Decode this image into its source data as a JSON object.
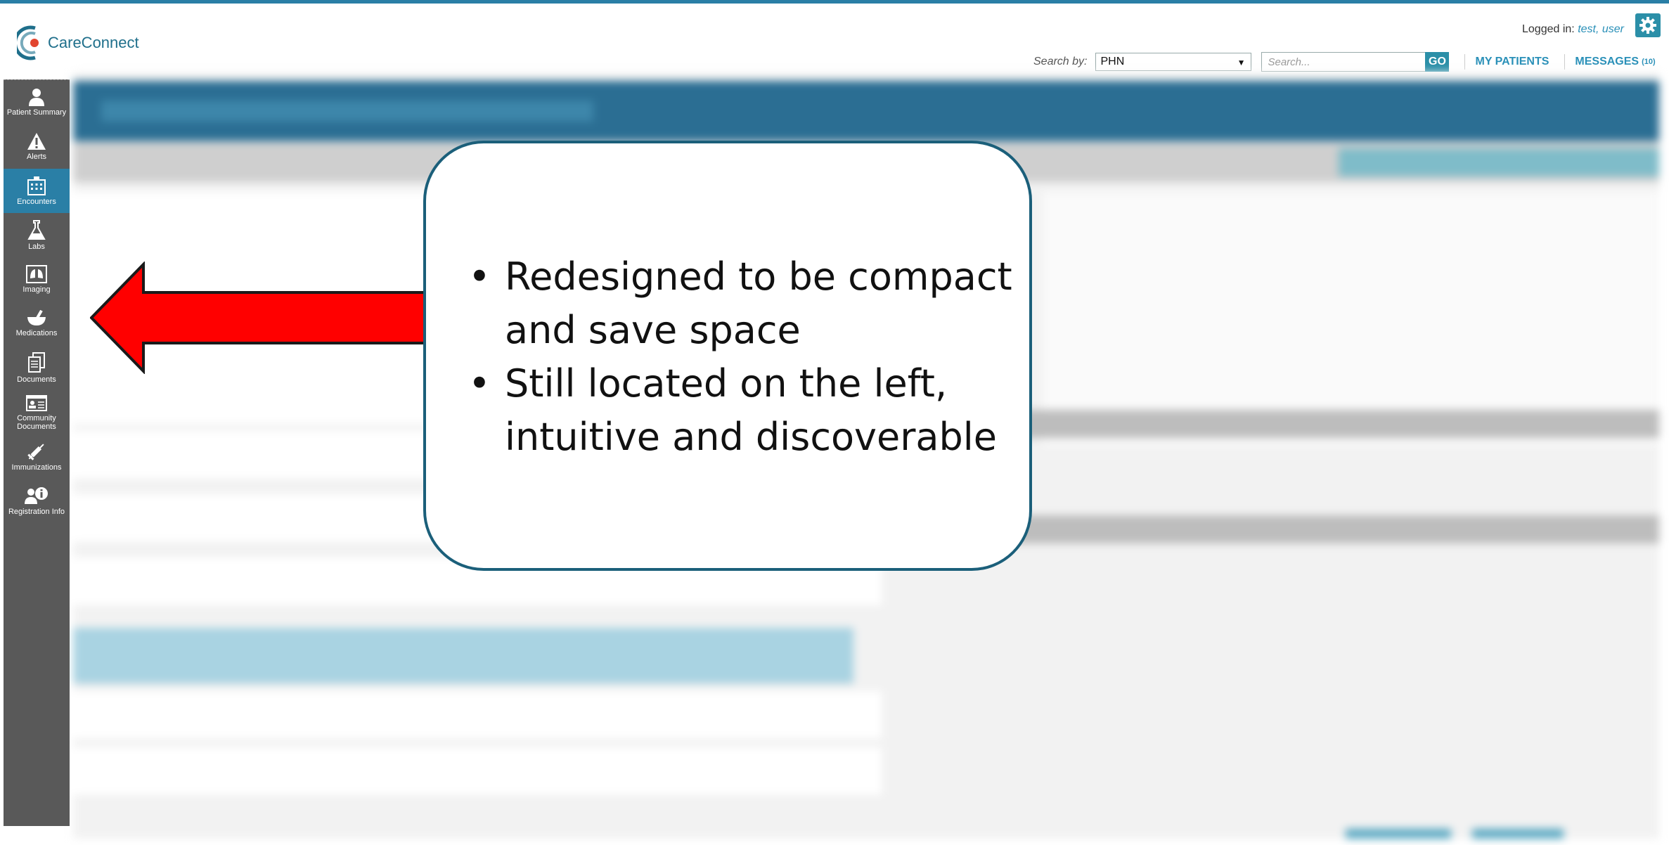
{
  "app": {
    "name": "CareConnect"
  },
  "header": {
    "logged_in_label": "Logged in:",
    "logged_in_user": "test, user",
    "search_by_label": "Search by:",
    "search_by_value": "PHN",
    "search_placeholder": "Search...",
    "go_label": "GO",
    "my_patients_label": "MY PATIENTS",
    "messages_label": "MESSAGES",
    "messages_count": "(10)"
  },
  "sidebar": {
    "items": [
      {
        "label": "Patient Summary",
        "icon": "person-icon"
      },
      {
        "label": "Alerts",
        "icon": "alert-icon"
      },
      {
        "label": "Encounters",
        "icon": "hospital-icon",
        "active": true
      },
      {
        "label": "Labs",
        "icon": "flask-icon"
      },
      {
        "label": "Imaging",
        "icon": "lungs-icon"
      },
      {
        "label": "Medications",
        "icon": "mortar-icon"
      },
      {
        "label": "Documents",
        "icon": "documents-icon"
      },
      {
        "label": "Community Documents",
        "icon": "id-card-icon"
      },
      {
        "label": "Immunizations",
        "icon": "syringe-icon"
      },
      {
        "label": "Registration Info",
        "icon": "registration-icon"
      }
    ]
  },
  "callout": {
    "bullets": [
      "Redesigned to be compact and save space",
      "Still located on the left, intuitive and discoverable"
    ]
  },
  "colors": {
    "accent": "#2a7fa6",
    "sidebar": "#595959",
    "arrow": "#ff0000",
    "callout_border": "#1b5f7a"
  }
}
